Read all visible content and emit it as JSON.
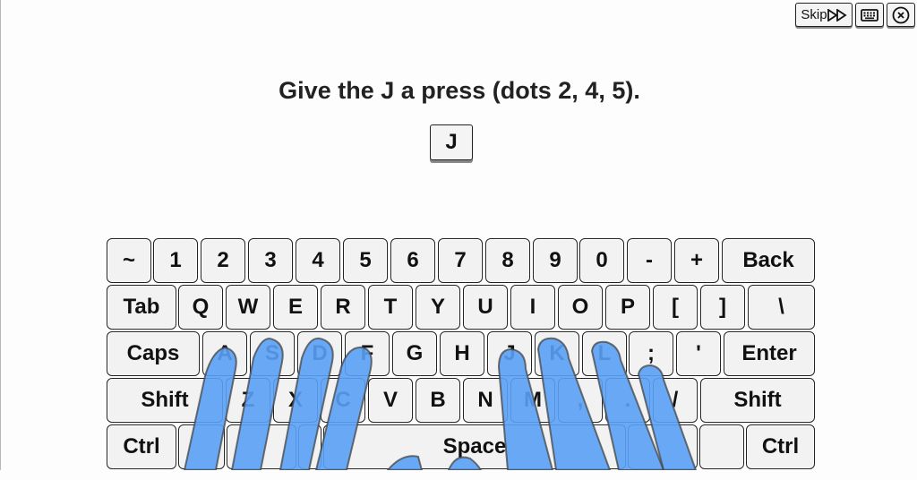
{
  "toolbar": {
    "skip_label": "Skip",
    "skip_icon": "double-play-icon",
    "keyboard_icon": "keyboard-icon",
    "close_icon": "close-circle-icon"
  },
  "lesson": {
    "prompt": "Give the J a press (dots 2, 4, 5).",
    "target_key": "J"
  },
  "keyboard": {
    "rows": [
      [
        "~",
        "1",
        "2",
        "3",
        "4",
        "5",
        "6",
        "7",
        "8",
        "9",
        "0",
        "-",
        "+",
        "Back"
      ],
      [
        "Tab",
        "Q",
        "W",
        "E",
        "R",
        "T",
        "Y",
        "U",
        "I",
        "O",
        "P",
        "[",
        "]",
        "\\"
      ],
      [
        "Caps",
        "A",
        "S",
        "D",
        "F",
        "G",
        "H",
        "J",
        "K",
        "L",
        ";",
        "'",
        "Enter"
      ],
      [
        "Shift",
        "Z",
        "X",
        "C",
        "V",
        "B",
        "N",
        "M",
        ",",
        ".",
        "/",
        "Shift"
      ],
      [
        "Ctrl",
        "",
        "",
        "",
        "Space",
        "",
        "",
        "Ctrl"
      ]
    ]
  },
  "hands": {
    "color": "#5aa0f5",
    "left_fingers_on": [
      "A",
      "S",
      "D",
      "F"
    ],
    "right_fingers_on": [
      "J",
      "K",
      "L",
      ";"
    ]
  }
}
